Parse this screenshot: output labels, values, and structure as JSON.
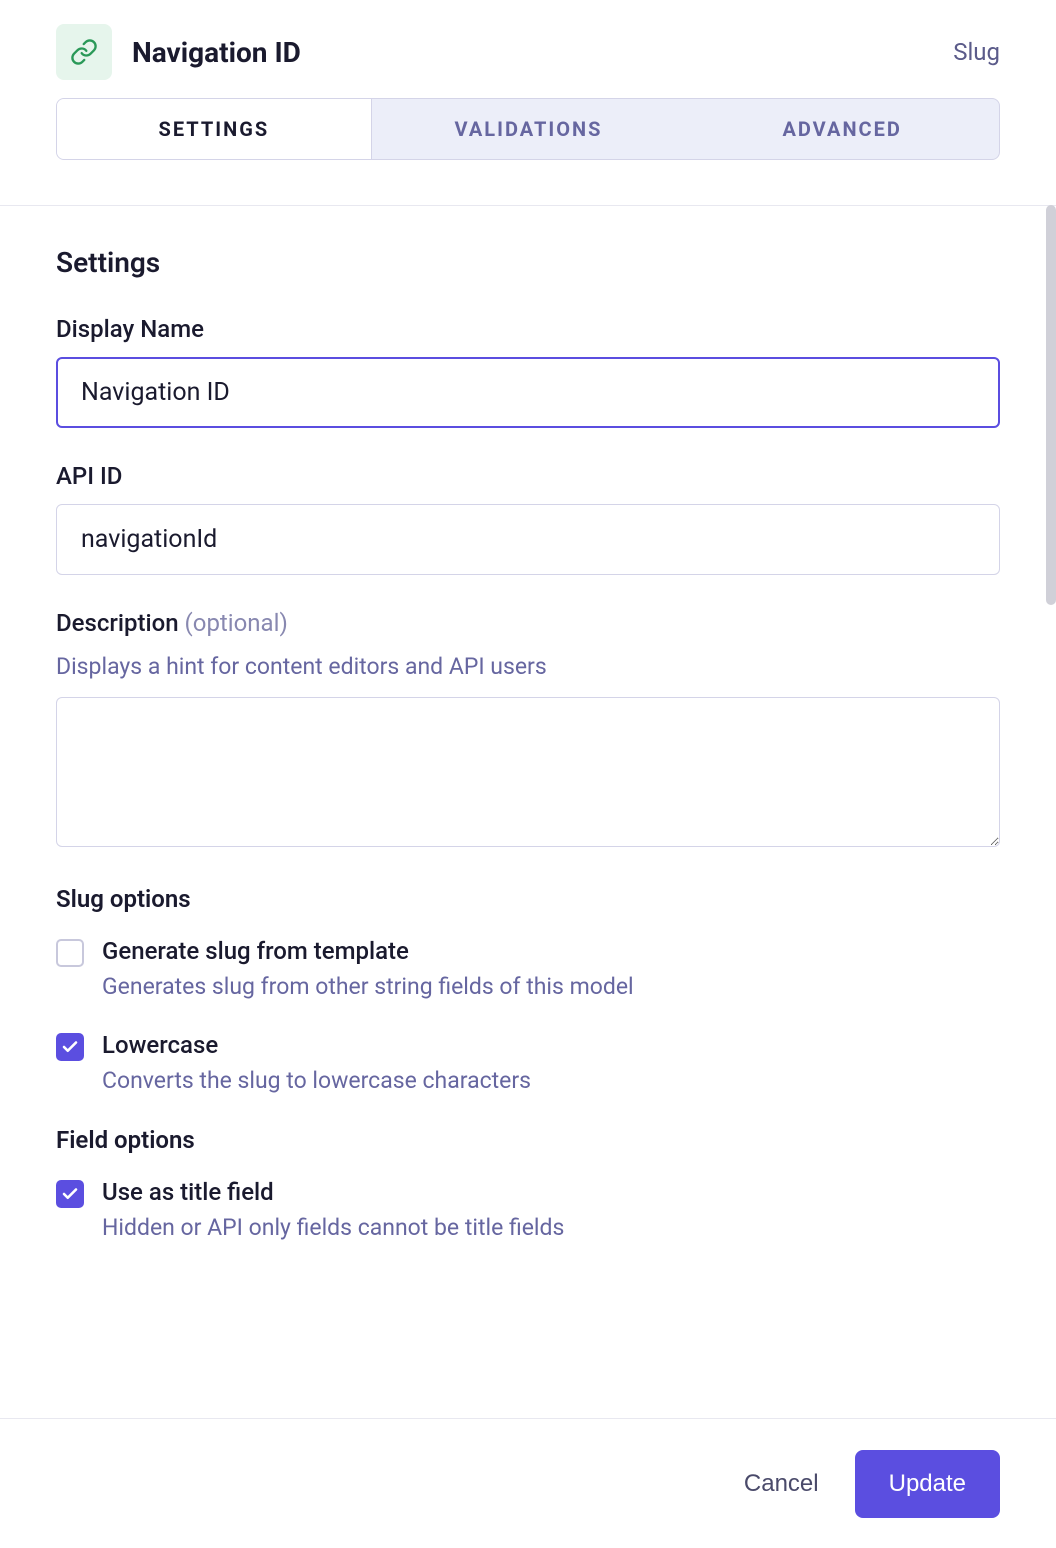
{
  "header": {
    "title": "Navigation ID",
    "type_label": "Slug"
  },
  "tabs": {
    "items": [
      {
        "label": "Settings",
        "active": true
      },
      {
        "label": "Validations",
        "active": false
      },
      {
        "label": "Advanced",
        "active": false
      }
    ]
  },
  "settings": {
    "section_title": "Settings",
    "display_name": {
      "label": "Display Name",
      "value": "Navigation ID"
    },
    "api_id": {
      "label": "API ID",
      "value": "navigationId"
    },
    "description": {
      "label": "Description",
      "optional_text": "(optional)",
      "hint": "Displays a hint for content editors and API users",
      "value": ""
    },
    "slug_options": {
      "title": "Slug options",
      "generate": {
        "label": "Generate slug from template",
        "desc": "Generates slug from other string fields of this model",
        "checked": false
      },
      "lowercase": {
        "label": "Lowercase",
        "desc": "Converts the slug to lowercase characters",
        "checked": true
      }
    },
    "field_options": {
      "title": "Field options",
      "title_field": {
        "label": "Use as title field",
        "desc": "Hidden or API only fields cannot be title fields",
        "checked": true
      }
    }
  },
  "footer": {
    "cancel": "Cancel",
    "update": "Update"
  }
}
